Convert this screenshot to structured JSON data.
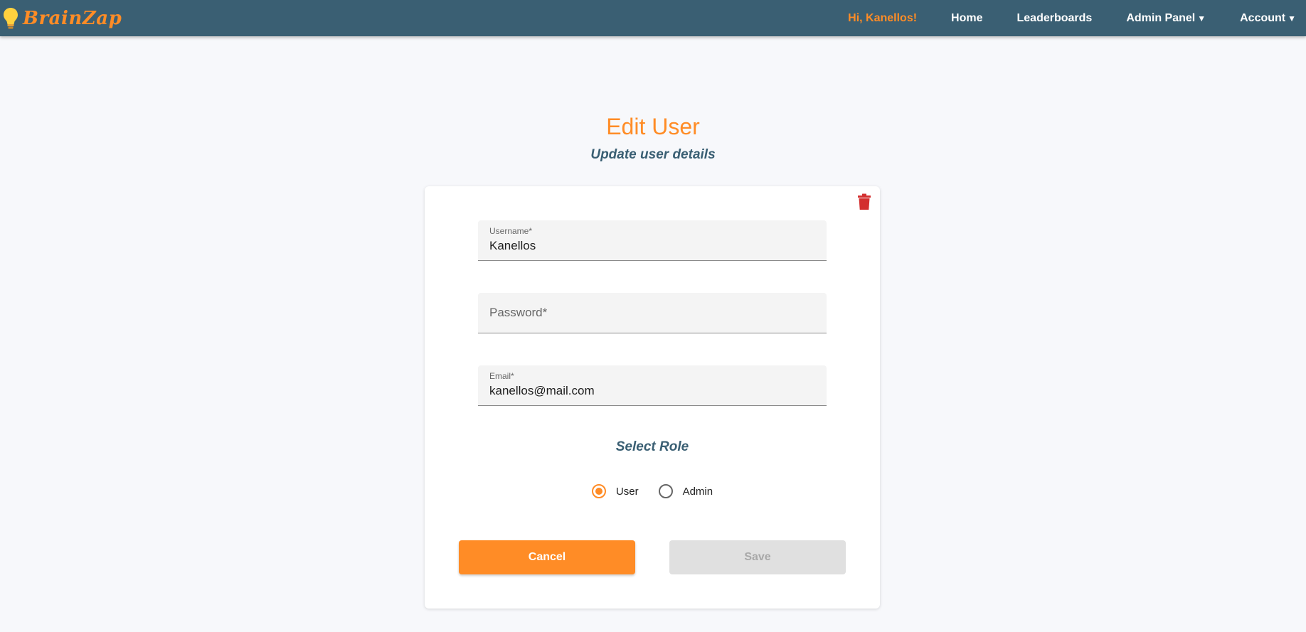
{
  "brand": {
    "name": "BrainZap",
    "icon": "lightbulb-icon"
  },
  "nav": {
    "greeting": "Hi, Kanellos!",
    "home": "Home",
    "leaderboards": "Leaderboards",
    "admin_panel": "Admin Panel",
    "account": "Account"
  },
  "page": {
    "title": "Edit User",
    "subtitle": "Update user details"
  },
  "form": {
    "username": {
      "label": "Username*",
      "value": "Kanellos"
    },
    "password": {
      "placeholder": "Password*",
      "value": ""
    },
    "email": {
      "label": "Email*",
      "value": "kanellos@mail.com"
    },
    "role_title": "Select Role",
    "roles": [
      {
        "label": "User",
        "selected": true
      },
      {
        "label": "Admin",
        "selected": false
      }
    ],
    "cancel_label": "Cancel",
    "save_label": "Save",
    "delete_icon": "trash-icon"
  },
  "colors": {
    "navbar": "#3a5f73",
    "accent": "#ff8c26",
    "danger": "#d32f2f",
    "disabled": "#e0e0e0"
  }
}
